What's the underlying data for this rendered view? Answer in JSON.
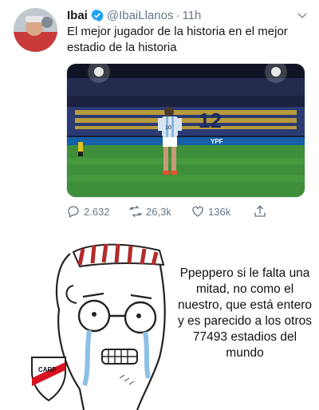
{
  "tweet": {
    "name": "Ibai",
    "handle": "@IbaiLlanos",
    "separator": "·",
    "time": "11h",
    "text": "El mejor jugador de la historia en el mejor estadio de la historia",
    "media_stadium_text": "12",
    "media_sponsor": "YPF",
    "player_number": "10",
    "stats": {
      "replies": "2.632",
      "retweets": "26,3k",
      "likes": "136k"
    }
  },
  "meme": {
    "text": "Ppeppero si le falta una mitad, no como el nuestro, que está entero y es parecido a los otros 77493 estadios del mundo",
    "badge_text": "CARP"
  },
  "colors": {
    "verified": "#1da1f2",
    "secondary_text": "#657786",
    "pitch": "#3f8f3a",
    "stands": "#2f3f7a",
    "river_red": "#d7131f"
  }
}
